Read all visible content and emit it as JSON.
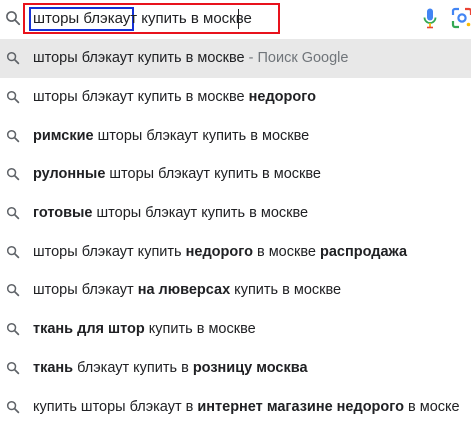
{
  "search": {
    "query": "шторы блэкаут купить в москве"
  },
  "suggestions": [
    {
      "parts": [
        {
          "t": "шторы блэкаут купить в москве",
          "b": false
        }
      ],
      "suffix": " - Поиск Google",
      "highlighted": true
    },
    {
      "parts": [
        {
          "t": "шторы блэкаут купить в москве ",
          "b": false
        },
        {
          "t": "недорого",
          "b": true
        }
      ]
    },
    {
      "parts": [
        {
          "t": "римские",
          "b": true
        },
        {
          "t": " шторы блэкаут купить в москве",
          "b": false
        }
      ]
    },
    {
      "parts": [
        {
          "t": "рулонные",
          "b": true
        },
        {
          "t": " шторы блэкаут купить в москве",
          "b": false
        }
      ]
    },
    {
      "parts": [
        {
          "t": "готовые",
          "b": true
        },
        {
          "t": " шторы блэкаут купить в москве",
          "b": false
        }
      ]
    },
    {
      "parts": [
        {
          "t": "шторы блэкаут купить ",
          "b": false
        },
        {
          "t": "недорого",
          "b": true
        },
        {
          "t": " в москве ",
          "b": false
        },
        {
          "t": "распродажа",
          "b": true
        }
      ]
    },
    {
      "parts": [
        {
          "t": "шторы блэкаут ",
          "b": false
        },
        {
          "t": "на люверсах",
          "b": true
        },
        {
          "t": " купить в москве",
          "b": false
        }
      ]
    },
    {
      "parts": [
        {
          "t": "ткань для штор",
          "b": true
        },
        {
          "t": " купить в москве",
          "b": false
        }
      ]
    },
    {
      "parts": [
        {
          "t": "ткань",
          "b": true
        },
        {
          "t": " блэкаут купить в ",
          "b": false
        },
        {
          "t": "розницу москва",
          "b": true
        }
      ]
    },
    {
      "parts": [
        {
          "t": "купить шторы блэкаут в ",
          "b": false
        },
        {
          "t": "интернет магазине недорого",
          "b": true
        },
        {
          "t": " в моске",
          "b": false
        }
      ]
    }
  ],
  "icons": {
    "search": "search-icon",
    "mic": "microphone-icon",
    "lens": "camera-lens-icon"
  },
  "colors": {
    "annotation_red": "#e8121c",
    "annotation_blue": "#1531d6",
    "highlight_row": "#e8e8e8",
    "mic_blue": "#4285f4"
  }
}
